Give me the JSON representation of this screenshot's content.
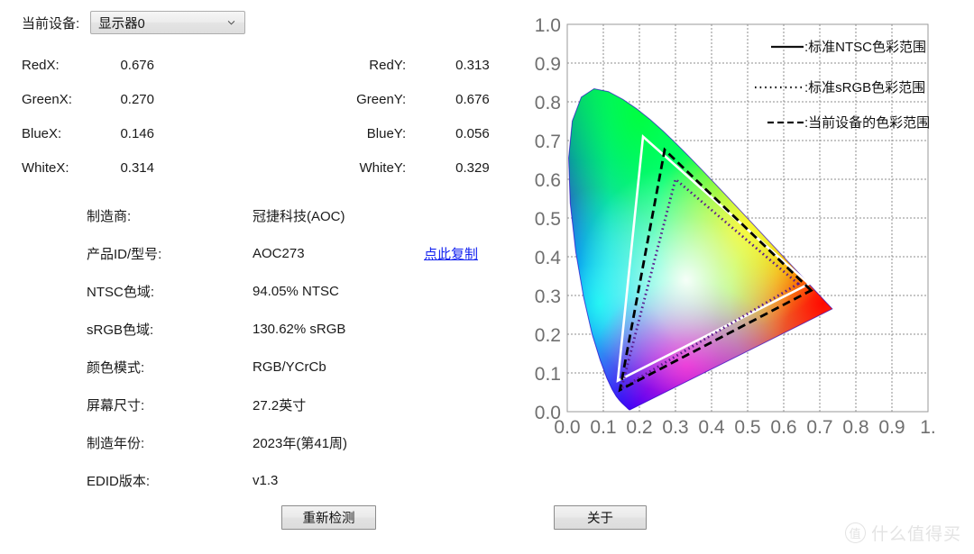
{
  "device": {
    "label": "当前设备:",
    "selected": "显示器0",
    "options": [
      "显示器0"
    ]
  },
  "coordinates": [
    {
      "label_x": "RedX:",
      "value_x": "0.676",
      "label_y": "RedY:",
      "value_y": "0.313"
    },
    {
      "label_x": "GreenX:",
      "value_x": "0.270",
      "label_y": "GreenY:",
      "value_y": "0.676"
    },
    {
      "label_x": "BlueX:",
      "value_x": "0.146",
      "label_y": "BlueY:",
      "value_y": "0.056"
    },
    {
      "label_x": "WhiteX:",
      "value_x": "0.314",
      "label_y": "WhiteY:",
      "value_y": "0.329"
    }
  ],
  "details": [
    {
      "key": "制造商:",
      "value": "冠捷科技(AOC)",
      "action": ""
    },
    {
      "key": "产品ID/型号:",
      "value": "AOC273",
      "action": "点此复制"
    },
    {
      "key": "NTSC色域:",
      "value": "94.05% NTSC",
      "action": ""
    },
    {
      "key": "sRGB色域:",
      "value": "130.62% sRGB",
      "action": ""
    },
    {
      "key": "颜色模式:",
      "value": "RGB/YCrCb",
      "action": ""
    },
    {
      "key": "屏幕尺寸:",
      "value": "27.2英寸",
      "action": ""
    },
    {
      "key": "制造年份:",
      "value": "2023年(第41周)",
      "action": ""
    },
    {
      "key": "EDID版本:",
      "value": "v1.3",
      "action": ""
    }
  ],
  "buttons": {
    "recheck": "重新检测",
    "about": "关于"
  },
  "watermark": {
    "badge": "值",
    "text": "什么值得买"
  },
  "chart_data": {
    "type": "scatter",
    "title": "",
    "xlabel": "",
    "ylabel": "",
    "xlim": [
      0.0,
      1.0
    ],
    "ylim": [
      0.0,
      1.0
    ],
    "grid": true,
    "x_ticks": [
      "0.0",
      "0.1",
      "0.2",
      "0.3",
      "0.4",
      "0.5",
      "0.6",
      "0.7",
      "0.8",
      "0.9",
      "1."
    ],
    "y_ticks": [
      "0.0",
      "0.1",
      "0.2",
      "0.3",
      "0.4",
      "0.5",
      "0.6",
      "0.7",
      "0.8",
      "0.9",
      "1.0"
    ],
    "legend_position": "top-right",
    "legend": [
      {
        "marker": "solid",
        "label": ":标准NTSC色彩范围"
      },
      {
        "marker": "dotted",
        "label": ":标准sRGB色彩范围"
      },
      {
        "marker": "dashed",
        "label": ":当前设备的色彩范围"
      }
    ],
    "series": [
      {
        "name": "标准NTSC色彩范围",
        "style": "solid",
        "color": "#ffffff",
        "points": [
          {
            "label": "Red",
            "x": 0.67,
            "y": 0.33
          },
          {
            "label": "Green",
            "x": 0.21,
            "y": 0.71
          },
          {
            "label": "Blue",
            "x": 0.14,
            "y": 0.08
          }
        ]
      },
      {
        "name": "标准sRGB色彩范围",
        "style": "dotted",
        "color": "#5a1a8c",
        "points": [
          {
            "label": "Red",
            "x": 0.64,
            "y": 0.33
          },
          {
            "label": "Green",
            "x": 0.3,
            "y": 0.6
          },
          {
            "label": "Blue",
            "x": 0.15,
            "y": 0.06
          }
        ]
      },
      {
        "name": "当前设备的色彩范围",
        "style": "dashed",
        "color": "#000000",
        "points": [
          {
            "label": "Red",
            "x": 0.676,
            "y": 0.313
          },
          {
            "label": "Green",
            "x": 0.27,
            "y": 0.676
          },
          {
            "label": "Blue",
            "x": 0.146,
            "y": 0.056
          }
        ]
      }
    ],
    "background": {
      "name": "CIE 1931 色度图",
      "description": "CIE chromaticity horseshoe spectral locus filled with visible-spectrum colors"
    }
  }
}
